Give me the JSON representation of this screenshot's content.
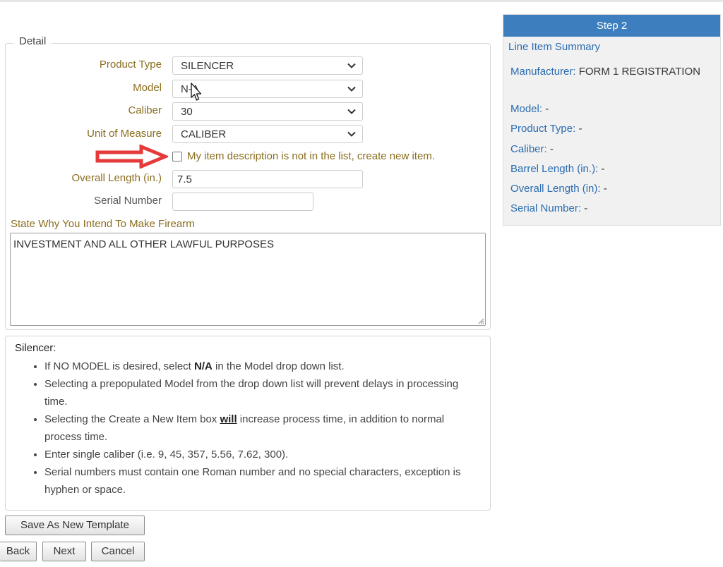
{
  "step": {
    "header": "Step 2",
    "summary_title": "Line Item Summary"
  },
  "summary": [
    {
      "key": "Manufacturer:",
      "value": " FORM 1 REGISTRATION"
    },
    {
      "key": "Model:",
      "value": " -"
    },
    {
      "key": "Product Type:",
      "value": " -"
    },
    {
      "key": "Caliber:",
      "value": " -"
    },
    {
      "key": "Barrel Length (in.):",
      "value": " -"
    },
    {
      "key": "Overall Length (in):",
      "value": " -"
    },
    {
      "key": "Serial Number:",
      "value": " -"
    }
  ],
  "detail": {
    "legend": "Detail",
    "product_type_label": "Product Type",
    "product_type_value": "SILENCER",
    "model_label": "Model",
    "model_value": "N-A",
    "caliber_label": "Caliber",
    "caliber_value": "30",
    "unit_label": "Unit of Measure",
    "unit_value": "CALIBER",
    "new_item_label": "My item description is not in the list, create new item.",
    "overall_length_label": "Overall Length (in.)",
    "overall_length_value": "7.5",
    "serial_label": "Serial Number",
    "serial_value": "",
    "why_label": "State Why You Intend To Make Firearm",
    "why_value": "INVESTMENT AND ALL OTHER LAWFUL PURPOSES"
  },
  "notes": {
    "title": "Silencer:",
    "items": [
      {
        "pre": "If NO MODEL is desired, select ",
        "em": "N/A",
        "post": " in the Model drop down list."
      },
      {
        "pre": "Selecting a prepopulated Model from the drop down list will prevent delays in processing time.",
        "em": "",
        "post": ""
      },
      {
        "pre": "Selecting the Create a New Item box ",
        "em": "will",
        "post": " increase process time, in addition to normal process time."
      },
      {
        "pre": "Enter single caliber (i.e. 9, 45, 357, 5.56, 7.62, 300).",
        "em": "",
        "post": ""
      },
      {
        "pre": "Serial numbers must contain one Roman number and no special characters, exception is hyphen or space.",
        "em": "",
        "post": ""
      }
    ]
  },
  "buttons": {
    "save_template": "Save As New Template",
    "back": "Back",
    "next": "Next",
    "cancel": "Cancel"
  },
  "icons": {
    "chevron": "chevron-down-icon",
    "arrow": "red-arrow-annotation-icon",
    "cursor": "mouse-pointer-icon"
  },
  "colors": {
    "label_gold": "#8a6d1e",
    "accent_blue": "#3d7ebf",
    "annotation_red": "#e53a3a"
  }
}
